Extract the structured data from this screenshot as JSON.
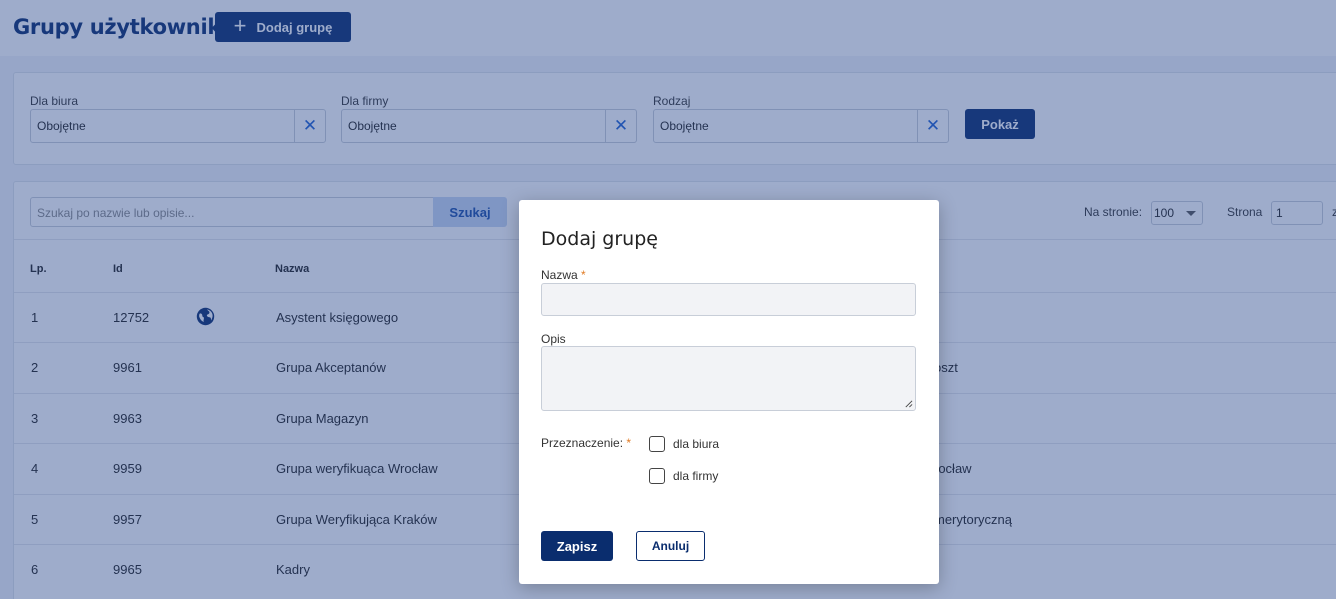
{
  "header": {
    "title": "Grupy użytkowników",
    "add_button_label": "Dodaj grupę",
    "add_button_icon": "plus-icon"
  },
  "filters": {
    "office": {
      "label": "Dla biura",
      "value": "Obojętne"
    },
    "company": {
      "label": "Dla firmy",
      "value": "Obojętne"
    },
    "type": {
      "label": "Rodzaj",
      "value": "Obojętne"
    },
    "show_label": "Pokaż"
  },
  "list": {
    "search_placeholder": "Szukaj po nazwie lub opisie...",
    "search_label": "Szukaj",
    "per_page_label": "Na stronie:",
    "per_page_value": "100",
    "page_label": "Strona",
    "page_value": "1",
    "page_of": "z",
    "columns": {
      "lp": "Lp.",
      "id": "Id",
      "name": "Nazwa"
    },
    "rows": [
      {
        "lp": "1",
        "id": "12752",
        "name": "Asystent księgowego",
        "tail": "",
        "global": true
      },
      {
        "lp": "2",
        "id": "9961",
        "name": "Grupa Akceptanów",
        "tail": "oszt",
        "global": false
      },
      {
        "lp": "3",
        "id": "9963",
        "name": "Grupa Magazyn",
        "tail": "",
        "global": false
      },
      {
        "lp": "4",
        "id": "9959",
        "name": "Grupa weryfikuąca Wrocław",
        "tail": "rocław",
        "global": false
      },
      {
        "lp": "5",
        "id": "9957",
        "name": "Grupa Weryfikująca Kraków",
        "tail": "merytoryczną",
        "global": false
      },
      {
        "lp": "6",
        "id": "9965",
        "name": "Kadry",
        "tail": "",
        "global": false
      }
    ]
  },
  "modal": {
    "title": "Dodaj grupę",
    "name_label": "Nazwa",
    "name_value": "",
    "required_mark": "*",
    "description_label": "Opis",
    "description_value": "",
    "purpose_label": "Przeznaczenie:",
    "option_office": "dla biura",
    "option_company": "dla firmy",
    "save_label": "Zapisz",
    "cancel_label": "Anuluj"
  },
  "colors": {
    "primary": "#0a2d6e",
    "accent_blue": "#1d5fd1",
    "required": "#e07b24",
    "overlay": "#28488c"
  }
}
